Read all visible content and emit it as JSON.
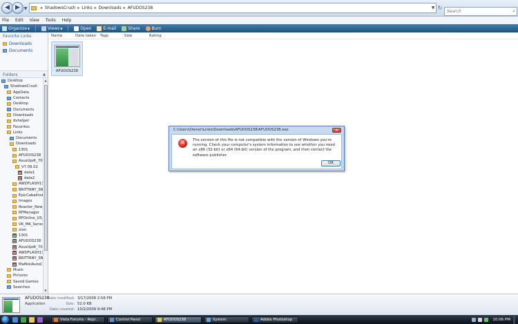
{
  "address_bar": {
    "breadcrumb": [
      "ShadowsCrush",
      "Links",
      "Downloads",
      "AFUDOS238"
    ],
    "separator": "▸",
    "search_placeholder": "Search"
  },
  "menu": [
    "File",
    "Edit",
    "View",
    "Tools",
    "Help"
  ],
  "toolbar": {
    "organize": "Organize",
    "views": "Views",
    "open": "Open",
    "email": "E-mail",
    "share": "Share",
    "burn": "Burn"
  },
  "nav": {
    "favorite_links_header": "Favorite Links",
    "favorites": [
      "Downloads",
      "Documents"
    ],
    "folders_header": "Folders",
    "tree": [
      {
        "label": "Desktop",
        "indent": 0,
        "icon": "special"
      },
      {
        "label": "ShadowsCrush",
        "indent": 1,
        "icon": "special"
      },
      {
        "label": "AppData",
        "indent": 2,
        "icon": "folder"
      },
      {
        "label": "Contacts",
        "indent": 2,
        "icon": "special"
      },
      {
        "label": "Desktop",
        "indent": 2,
        "icon": "folder"
      },
      {
        "label": "Documents",
        "indent": 2,
        "icon": "special"
      },
      {
        "label": "Downloads",
        "indent": 2,
        "icon": "folder"
      },
      {
        "label": "dvhelper",
        "indent": 2,
        "icon": "folder"
      },
      {
        "label": "Favorites",
        "indent": 2,
        "icon": "folder"
      },
      {
        "label": "Links",
        "indent": 2,
        "icon": "folder"
      },
      {
        "label": "Documents",
        "indent": 3,
        "icon": "special"
      },
      {
        "label": "Downloads",
        "indent": 3,
        "icon": "folder"
      },
      {
        "label": "1301",
        "indent": 4,
        "icon": "folder"
      },
      {
        "label": "AFUDOS238",
        "indent": 4,
        "icon": "folder"
      },
      {
        "label": "AsusUpdt_70902",
        "indent": 4,
        "icon": "folder"
      },
      {
        "label": "V7.09.02",
        "indent": 5,
        "icon": "folder"
      },
      {
        "label": "data1",
        "indent": 6,
        "icon": "app"
      },
      {
        "label": "data2",
        "indent": 6,
        "icon": "app"
      },
      {
        "label": "AWDFLASH134",
        "indent": 4,
        "icon": "folder"
      },
      {
        "label": "BRITTANY_SNOW",
        "indent": 4,
        "icon": "folder"
      },
      {
        "label": "EpicCabalInstall",
        "indent": 4,
        "icon": "folder"
      },
      {
        "label": "Images",
        "indent": 4,
        "icon": "folder"
      },
      {
        "label": "Reactor_New_Lo",
        "indent": 4,
        "icon": "folder"
      },
      {
        "label": "RFManager",
        "indent": 4,
        "icon": "folder"
      },
      {
        "label": "RFOnline_US_v10",
        "indent": 4,
        "icon": "folder"
      },
      {
        "label": "VK_MK_SeriesLife",
        "indent": 4,
        "icon": "folder"
      },
      {
        "label": "xion",
        "indent": 4,
        "icon": "folder"
      },
      {
        "label": "1301",
        "indent": 4,
        "icon": "app"
      },
      {
        "label": "AFUDOS238",
        "indent": 4,
        "icon": "app"
      },
      {
        "label": "AsusUpdt_70902",
        "indent": 4,
        "icon": "app"
      },
      {
        "label": "AWDFLASH134",
        "indent": 4,
        "icon": "app"
      },
      {
        "label": "BRITTANY_SNOW",
        "indent": 4,
        "icon": "app"
      },
      {
        "label": "MafikkiAutoClick",
        "indent": 4,
        "icon": "app"
      },
      {
        "label": "Music",
        "indent": 2,
        "icon": "folder"
      },
      {
        "label": "Pictures",
        "indent": 2,
        "icon": "folder"
      },
      {
        "label": "Saved Games",
        "indent": 2,
        "icon": "folder"
      },
      {
        "label": "Searches",
        "indent": 2,
        "icon": "special"
      }
    ]
  },
  "columns": [
    "Name",
    "Date taken",
    "Tags",
    "Size",
    "Rating"
  ],
  "file": {
    "name": "AFUDOS238"
  },
  "dialog": {
    "title": "C:\\Users\\Owner\\Links\\Downloads\\AFUDOS238\\AFUDOS238.exe",
    "close": "✕",
    "message": "The version of this file is not compatible with the version of Windows you're running. Check your computer's system information to see whether you need an x86 (32-bit) or x64 (64-bit) version of the program, and then contact the software publisher.",
    "ok": "OK"
  },
  "details": {
    "name": "AFUDOS238",
    "type": "Application",
    "date_modified_label": "Date modified:",
    "date_modified": "3/17/2008 2:58 PM",
    "size_label": "Size:",
    "size": "52.0 KB",
    "date_created_label": "Date created:",
    "date_created": "10/2/2009 9:48 PM"
  },
  "taskbar": {
    "tasks": [
      {
        "label": "Vista Forums - Repl...",
        "icon_color": "#e07b2c"
      },
      {
        "label": "Control Panel",
        "icon_color": "#5a8fd0"
      },
      {
        "label": "AFUDOS238",
        "icon_color": "#e9c55c"
      },
      {
        "label": "System",
        "icon_color": "#6aa3d8"
      },
      {
        "label": "Adobe Photoshop",
        "icon_color": "#2d5fa0"
      }
    ],
    "clock": "10:06 PM"
  },
  "colors": {
    "toolbar_top": "#3e7fae",
    "toolbar_bottom": "#20527f",
    "error_red": "#d0281c"
  }
}
